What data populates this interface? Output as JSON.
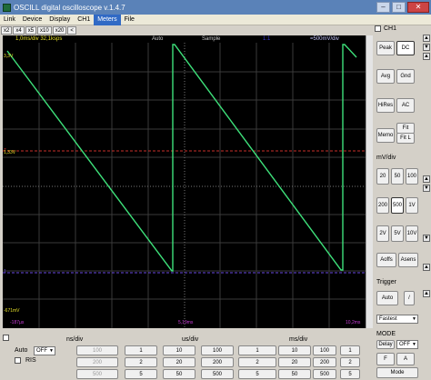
{
  "window": {
    "title": "OSCILL digital oscilloscope  v.1.4.7"
  },
  "menu": [
    "Link",
    "Device",
    "Display",
    "CH1",
    "Meters",
    "File"
  ],
  "menu_active": "Meters",
  "zoom": [
    "x2",
    "x4",
    "x5",
    "x10",
    "x20",
    "<"
  ],
  "screen": {
    "timebase": "1,0ms/div  32,1ksps",
    "trigger_mode": "Auto",
    "acq_mode": "Sample",
    "acq_extra": "1:1",
    "volts_div": "=500mV/div",
    "level_top": "3,3V",
    "level_mid": "1,33V",
    "marker_T": "T",
    "level_bottom": "-671mV",
    "time_left": "-187µs",
    "time_mid": "5,19ms",
    "time_right": "10,2ms",
    "marker_1": "1"
  },
  "right": {
    "ch1_label": "CH1",
    "peak": "Peak",
    "dc": "DC",
    "avg": "Avg",
    "gnd": "Gnd",
    "hires": "HiRes",
    "ac": "AC",
    "memo": "Memo",
    "fit": "Fit",
    "fit_l": "Fit L",
    "mvdiv": "mV/div",
    "mv_grid": [
      "20",
      "50",
      "100",
      "200",
      "500",
      "1V",
      "2V",
      "5V",
      "10V"
    ],
    "aoffs": "Aoffs",
    "asens": "Asens",
    "trigger": "Trigger",
    "auto": "Auto",
    "trig_slope": "/",
    "fastest": "Fastest",
    "mode": "MODE",
    "delay": "Delay",
    "off": "OFF",
    "f": "F",
    "a": "A",
    "mode_btn": "Mode"
  },
  "bottom": {
    "auto": "Auto",
    "auto_val": "OFF",
    "ris": "RIS",
    "ns_div": "ns/div",
    "us_div": "us/div",
    "ms_div": "ms/div",
    "ns_grid": [
      "100",
      "200",
      "500"
    ],
    "us_grid": [
      "1",
      "10",
      "100",
      "2",
      "20",
      "200",
      "5",
      "50",
      "500"
    ],
    "ms_grid": [
      "1",
      "10",
      "100",
      "2",
      "20",
      "200",
      "5",
      "50",
      "500"
    ],
    "s_grid": [
      "1",
      "2",
      "5"
    ]
  }
}
